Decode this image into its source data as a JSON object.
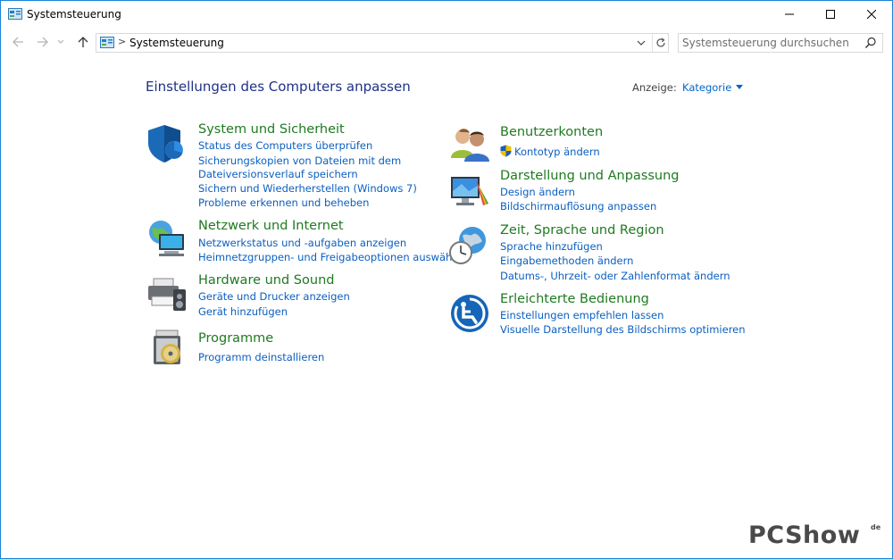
{
  "window": {
    "title": "Systemsteuerung"
  },
  "address": {
    "path": "Systemsteuerung",
    "separator": ">"
  },
  "search": {
    "placeholder": "Systemsteuerung durchsuchen"
  },
  "header": {
    "title": "Einstellungen des Computers anpassen",
    "view_label": "Anzeige:",
    "view_value": "Kategorie"
  },
  "categories": [
    {
      "title": "System und Sicherheit",
      "icon": "shield-icon",
      "links": [
        "Status des Computers überprüfen",
        "Sicherungskopien von Dateien mit dem",
        "Dateiversionsverlauf speichern",
        "Sichern und Wiederherstellen (Windows 7)",
        "Probleme erkennen und beheben"
      ]
    },
    {
      "title": "Netzwerk und Internet",
      "icon": "network-globe-icon",
      "links": [
        "Netzwerkstatus und -aufgaben anzeigen",
        "Heimnetzgruppen- und Freigabeoptionen auswählen"
      ]
    },
    {
      "title": "Hardware und Sound",
      "icon": "printer-speaker-icon",
      "links": [
        "Geräte und Drucker anzeigen",
        "Gerät hinzufügen"
      ]
    },
    {
      "title": "Programme",
      "icon": "programs-disc-icon",
      "links": [
        "Programm deinstallieren"
      ]
    },
    {
      "title": "Benutzerkonten",
      "icon": "users-icon",
      "links": [
        "Kontotyp ändern"
      ]
    },
    {
      "title": "Darstellung und Anpassung",
      "icon": "display-palette-icon",
      "links": [
        "Design ändern",
        "Bildschirmauflösung anpassen"
      ]
    },
    {
      "title": "Zeit, Sprache und Region",
      "icon": "clock-globe-icon",
      "links": [
        "Sprache hinzufügen",
        "Eingabemethoden ändern",
        "Datums-, Uhrzeit- oder Zahlenformat ändern"
      ]
    },
    {
      "title": "Erleichterte Bedienung",
      "icon": "accessibility-icon",
      "links": [
        "Einstellungen empfehlen lassen",
        "Visuelle Darstellung des Bildschirms optimieren"
      ]
    }
  ],
  "watermark": {
    "text": "PCShow",
    "superscript": "de"
  },
  "colors": {
    "category_title": "#1f7a21",
    "link": "#0b5fc0",
    "page_title": "#1e3287",
    "window_border": "#1883d7"
  }
}
